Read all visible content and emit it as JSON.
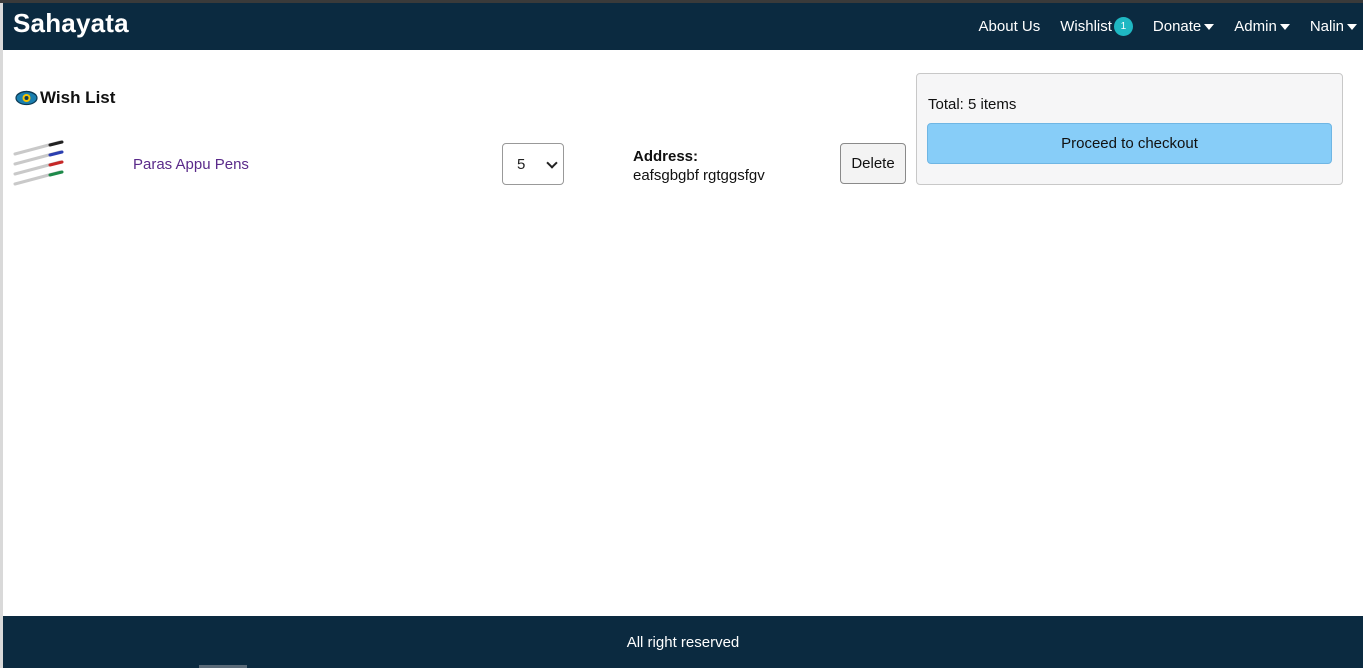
{
  "navbar": {
    "brand": "Sahayata",
    "links": {
      "about": "About Us",
      "wishlist": "Wishlist",
      "wishlist_count": "1",
      "donate": "Donate",
      "admin": "Admin",
      "user": "Nalin"
    }
  },
  "wishlist": {
    "heading": "Wish List",
    "items": [
      {
        "name": "Paras Appu Pens",
        "quantity": "5",
        "address_label": "Address:",
        "address": "eafsgbgbf rgtggsfgv",
        "delete_label": "Delete"
      }
    ]
  },
  "summary": {
    "total": "Total: 5 items",
    "checkout_label": "Proceed to checkout"
  },
  "footer": {
    "text": "All right reserved"
  },
  "colors": {
    "navbar_bg": "#0b2a40",
    "badge": "#1fb8c3",
    "checkout_btn": "#87cdf8",
    "item_link": "#5a2a8a"
  }
}
